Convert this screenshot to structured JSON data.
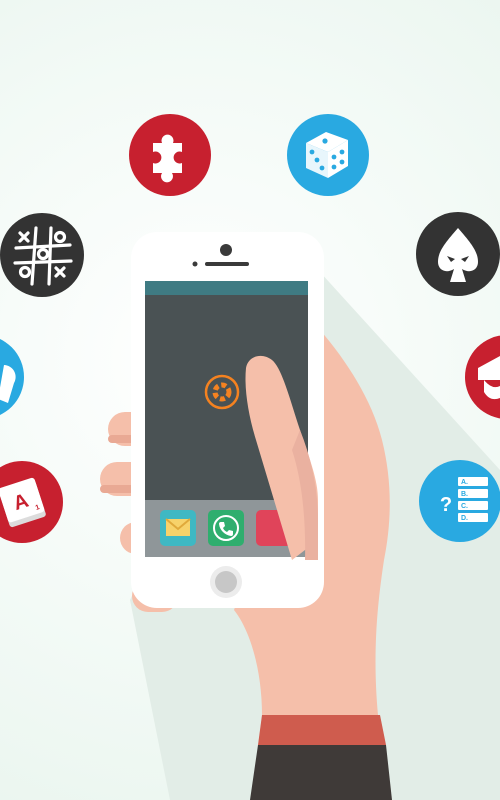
{
  "colors": {
    "background": "#eef8f2",
    "red": "#c7202f",
    "blue": "#29a9e1",
    "dark": "#333333",
    "skin": "#f5bfaa",
    "sleeve_cuff": "#cf5c4e",
    "sleeve": "#3f3a38",
    "phone_body": "#ffffff",
    "screen_bg": "#4a5254",
    "screen_topbar": "#3f7b83",
    "dock": "#8f9699",
    "spinner": "#f58220",
    "shadow": "#e3ede8"
  },
  "icons": [
    {
      "name": "puzzle-piece-icon",
      "color": "red"
    },
    {
      "name": "dice-icon",
      "color": "blue"
    },
    {
      "name": "tic-tac-toe-icon",
      "color": "dark"
    },
    {
      "name": "spade-card-icon",
      "color": "dark"
    },
    {
      "name": "controller-icon",
      "color": "blue"
    },
    {
      "name": "graduation-cap-icon",
      "color": "red"
    },
    {
      "name": "letter-tile-icon",
      "color": "red"
    },
    {
      "name": "quiz-options-icon",
      "color": "blue"
    }
  ],
  "letter_tile": {
    "letter": "A",
    "score": "1"
  },
  "quiz": {
    "question_mark": "?",
    "options": [
      "A.",
      "B.",
      "C.",
      "D."
    ]
  },
  "dock_apps": [
    "mail-app-icon",
    "phone-app-icon",
    "red-app-icon"
  ]
}
